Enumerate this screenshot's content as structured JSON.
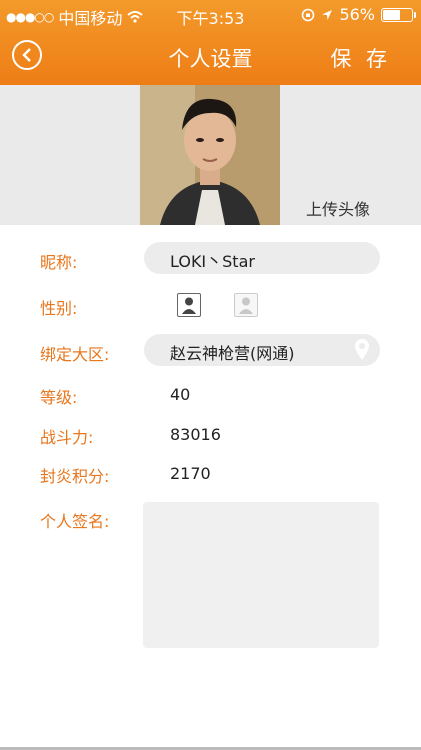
{
  "status_bar": {
    "signal": "●●●○○",
    "carrier": "中国移动",
    "time": "下午3:53",
    "battery_percent": "56%",
    "battery_level": 0.56
  },
  "nav": {
    "title": "个人设置",
    "save_label": "保 存"
  },
  "avatar": {
    "upload_label": "上传头像"
  },
  "form": {
    "nickname_label": "昵称:",
    "nickname_value": "LOKI丶Star",
    "gender_label": "性别:",
    "region_label": "绑定大区:",
    "region_value": "赵云神枪营(网通)",
    "level_label": "等级:",
    "level_value": "40",
    "power_label": "战斗力:",
    "power_value": "83016",
    "score_label": "封炎积分:",
    "score_value": "2170",
    "signature_label": "个人签名:"
  },
  "colors": {
    "accent": "#ee7d16",
    "label": "#e8761c"
  }
}
